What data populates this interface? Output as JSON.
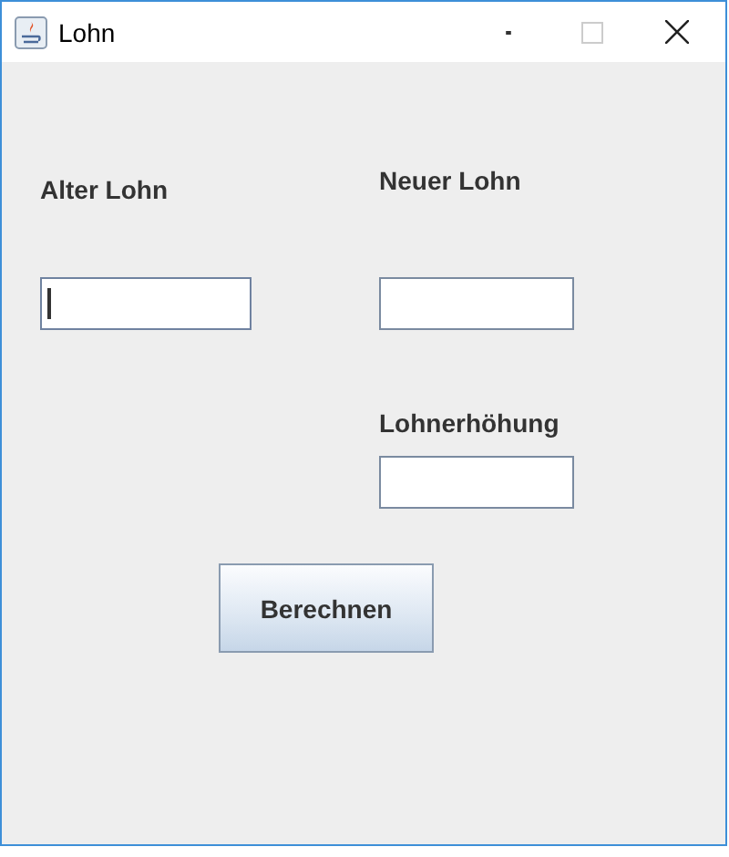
{
  "window": {
    "title": "Lohn"
  },
  "left_column": {
    "fields": [
      {
        "label": "Alter Lohn",
        "focused": true
      }
    ]
  },
  "right_column": {
    "fields": [
      {
        "label": "Neuer Lohn",
        "focused": false
      },
      {
        "label": "Lohnerhöhung",
        "focused": false
      }
    ]
  },
  "button": {
    "label": "Berechnen"
  }
}
